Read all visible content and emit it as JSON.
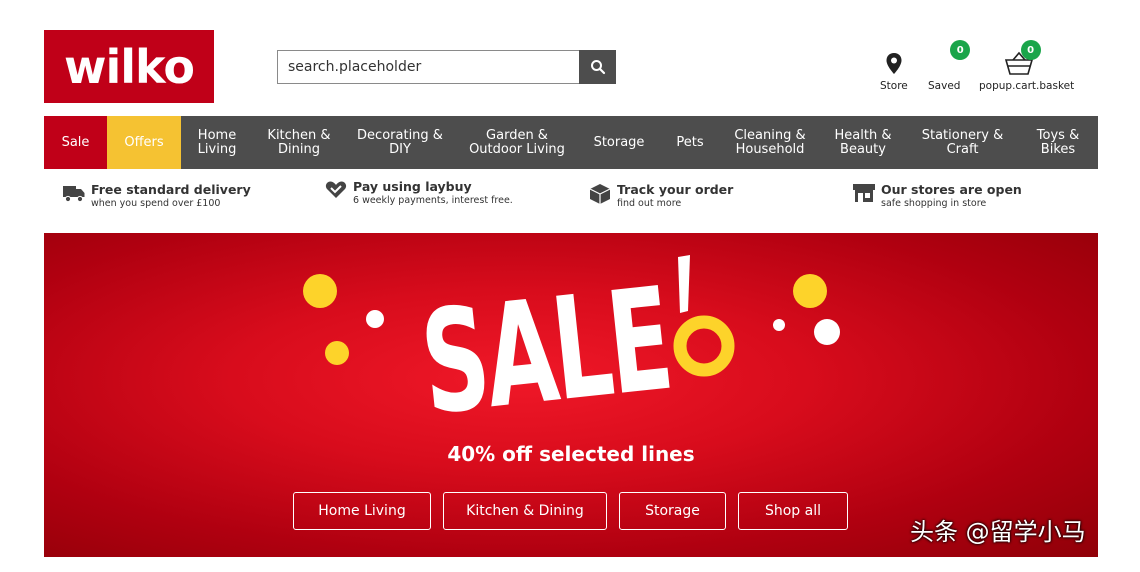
{
  "header": {
    "logo": "wilko",
    "search": {
      "placeholder": "search.placeholder",
      "value": ""
    },
    "store_label": "Store",
    "saved_label": "Saved",
    "saved_count": "0",
    "basket_label": "popup.cart.basket",
    "basket_count": "0"
  },
  "nav": {
    "items": [
      {
        "line1": "Sale",
        "line2": ""
      },
      {
        "line1": "Offers",
        "line2": ""
      },
      {
        "line1": "Home",
        "line2": "Living"
      },
      {
        "line1": "Kitchen &",
        "line2": "Dining"
      },
      {
        "line1": "Decorating &",
        "line2": "DIY"
      },
      {
        "line1": "Garden &",
        "line2": "Outdoor Living"
      },
      {
        "line1": "Storage",
        "line2": ""
      },
      {
        "line1": "Pets",
        "line2": ""
      },
      {
        "line1": "Cleaning &",
        "line2": "Household"
      },
      {
        "line1": "Health &",
        "line2": "Beauty"
      },
      {
        "line1": "Stationery &",
        "line2": "Craft"
      },
      {
        "line1": "Toys &",
        "line2": "Bikes"
      }
    ]
  },
  "usp": [
    {
      "title": "Free standard delivery",
      "sub": "when you spend over £100",
      "icon": "truck-icon"
    },
    {
      "title": "Pay using laybuy",
      "sub": "6 weekly payments, interest free.",
      "icon": "heart-icon"
    },
    {
      "title": "Track your order",
      "sub": "find out more",
      "icon": "box-icon"
    },
    {
      "title": "Our stores are open",
      "sub": "safe shopping in store",
      "icon": "store-icon"
    }
  ],
  "hero": {
    "headline": "SALE",
    "subline": "40% off selected lines",
    "buttons": [
      "Home Living",
      "Kitchen & Dining",
      "Storage",
      "Shop all"
    ]
  },
  "watermark": "头条 @留学小马",
  "colors": {
    "brand_red": "#c00018",
    "offers_yellow": "#f5c232",
    "nav_grey": "#4d4d4d",
    "badge_green": "#1aa54a",
    "accent_yellow": "#fdd32a"
  }
}
